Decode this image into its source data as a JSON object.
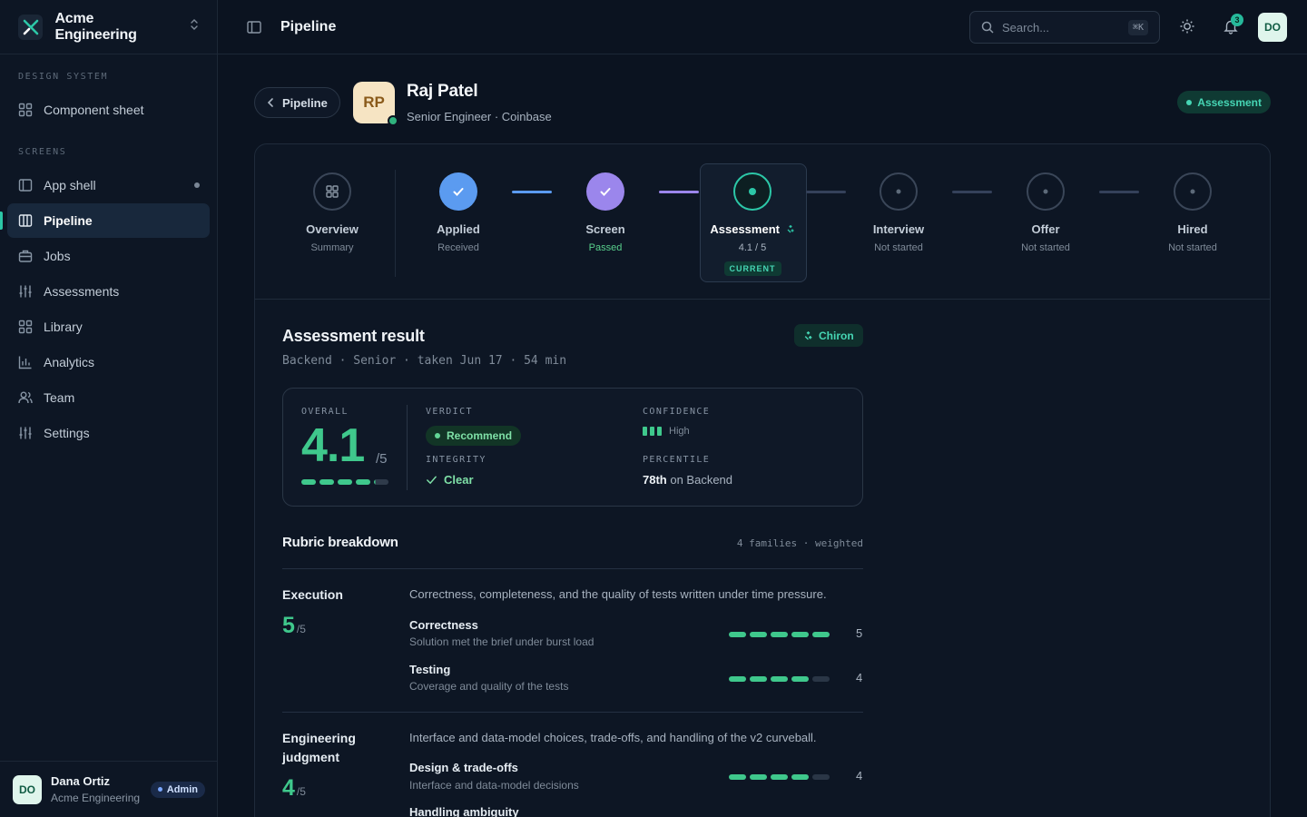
{
  "brand": {
    "name": "Acme Engineering"
  },
  "sidebar": {
    "section_design": "DESIGN SYSTEM",
    "section_screens": "SCREENS",
    "items": [
      {
        "label": "Component sheet",
        "icon": "grid-icon"
      },
      {
        "label": "App shell",
        "icon": "panel-icon"
      },
      {
        "label": "Pipeline",
        "icon": "columns-icon"
      },
      {
        "label": "Jobs",
        "icon": "briefcase-icon"
      },
      {
        "label": "Assessments",
        "icon": "sliders-icon"
      },
      {
        "label": "Library",
        "icon": "grid-icon"
      },
      {
        "label": "Analytics",
        "icon": "bar-chart-icon"
      },
      {
        "label": "Team",
        "icon": "users-icon"
      },
      {
        "label": "Settings",
        "icon": "sliders-icon"
      }
    ],
    "user": {
      "initials": "DO",
      "name": "Dana Ortiz",
      "org": "Acme Engineering",
      "role": "Admin"
    }
  },
  "header": {
    "title": "Pipeline",
    "search_placeholder": "Search...",
    "search_shortcut": "⌘K",
    "notification_count": "3",
    "avatar": "DO"
  },
  "candidate": {
    "back_label": "Pipeline",
    "initials": "RP",
    "name": "Raj Patel",
    "role": "Senior Engineer · Coinbase",
    "stage": "Assessment"
  },
  "stepper": [
    {
      "label": "Overview",
      "sub": "Summary"
    },
    {
      "label": "Applied",
      "sub": "Received"
    },
    {
      "label": "Screen",
      "sub": "Passed"
    },
    {
      "label": "Assessment",
      "sub": "4.1 / 5",
      "tag": "CURRENT"
    },
    {
      "label": "Interview",
      "sub": "Not started"
    },
    {
      "label": "Offer",
      "sub": "Not started"
    },
    {
      "label": "Hired",
      "sub": "Not started"
    }
  ],
  "result": {
    "title": "Assessment result",
    "meta": "Backend · Senior · taken Jun 17 · 54 min",
    "badge": "Chiron",
    "overall_label": "OVERALL",
    "score": "4.1",
    "score_of": "/5",
    "score_value": 4.1,
    "verdict_label": "VERDICT",
    "verdict": "Recommend",
    "integrity_label": "INTEGRITY",
    "integrity": "Clear",
    "confidence_label": "CONFIDENCE",
    "confidence": "High",
    "percentile_label": "PERCENTILE",
    "percentile": "78th",
    "percentile_suffix": "on Backend"
  },
  "rubric": {
    "title": "Rubric breakdown",
    "meta": "4 families · weighted",
    "families": [
      {
        "name": "Execution",
        "score": "5",
        "of": "/5",
        "desc": "Correctness, completeness, and the quality of tests written under time pressure.",
        "criteria": [
          {
            "name": "Correctness",
            "sub": "Solution met the brief under burst load",
            "value": "5",
            "level": 5
          },
          {
            "name": "Testing",
            "sub": "Coverage and quality of the tests",
            "value": "4",
            "level": 4
          }
        ]
      },
      {
        "name": "Engineering judgment",
        "score": "4",
        "of": "/5",
        "desc": "Interface and data-model choices, trade-offs, and handling of the v2 curveball.",
        "criteria": [
          {
            "name": "Design & trade-offs",
            "sub": "Interface and data-model decisions",
            "value": "4",
            "level": 4
          },
          {
            "name": "Handling ambiguity",
            "sub": "",
            "value": "",
            "level": 0
          }
        ]
      }
    ]
  },
  "colors": {
    "accent": "#2cc7a7",
    "score": "#3fc88c",
    "applied": "#5b9bf0",
    "screen": "#9b86ec"
  }
}
